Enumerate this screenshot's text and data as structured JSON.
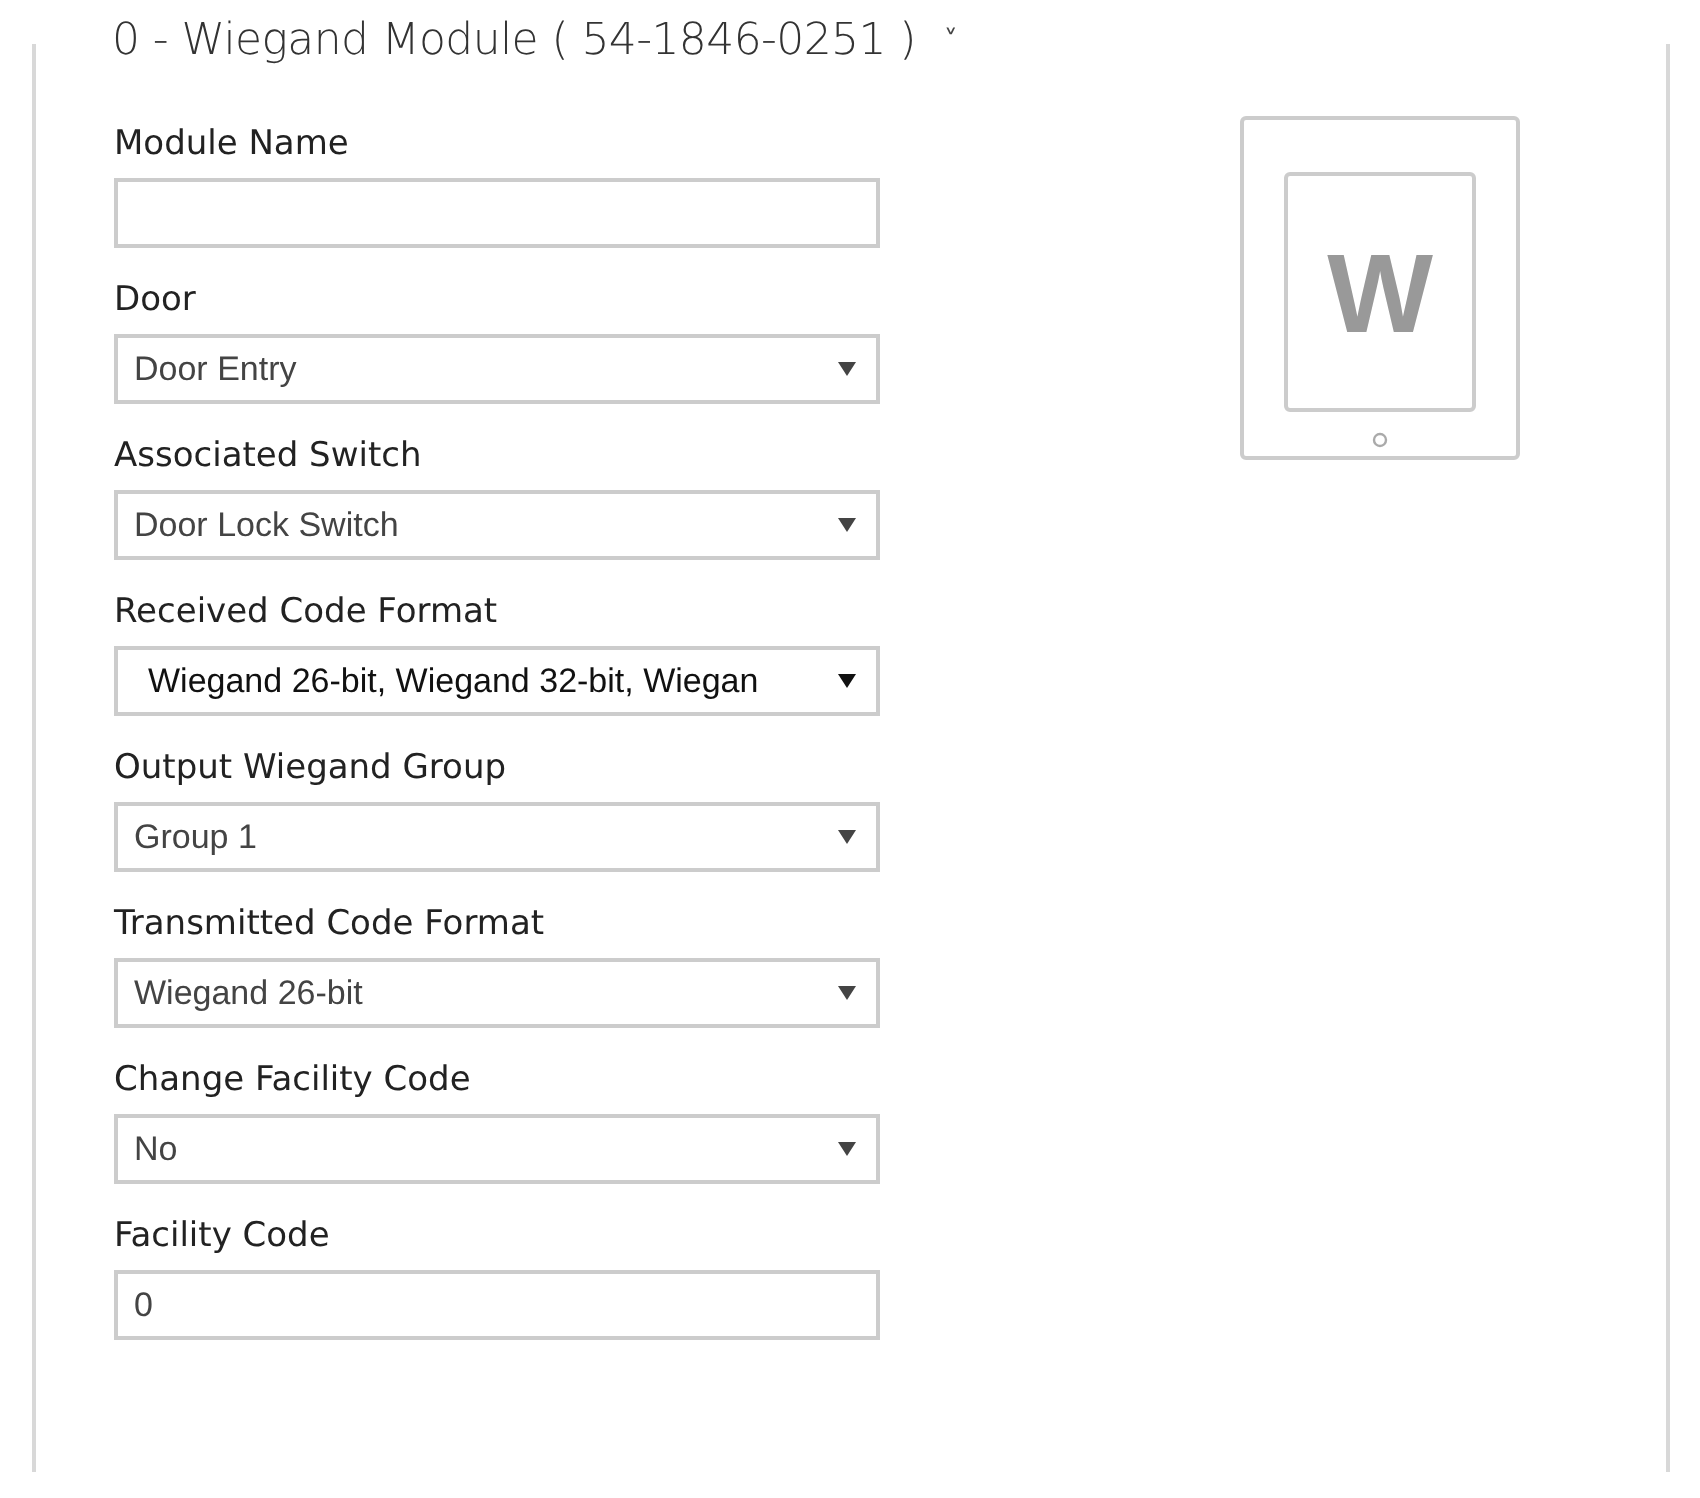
{
  "title": "0 - Wiegand Module ( 54-1846-0251 )",
  "title_chevron": "˅",
  "fields": [
    {
      "label": "Module Name",
      "kind": "text"
    },
    {
      "label": "Door",
      "kind": "select",
      "value": "Door Entry"
    },
    {
      "label": "Associated Switch",
      "kind": "select",
      "value": "Door Lock Switch"
    },
    {
      "label": "Received Code Format",
      "kind": "multiselect",
      "value": "Wiegand 26-bit, Wiegand 32-bit, Wiegan"
    },
    {
      "label": "Output Wiegand Group",
      "kind": "select",
      "value": "Group 1"
    },
    {
      "label": "Transmitted Code Format",
      "kind": "select",
      "value": "Wiegand 26-bit"
    },
    {
      "label": "Change Facility Code",
      "kind": "select",
      "value": "No"
    },
    {
      "label": "Facility Code",
      "kind": "text",
      "value": "0"
    }
  ],
  "module_image": {
    "letter": "W"
  }
}
